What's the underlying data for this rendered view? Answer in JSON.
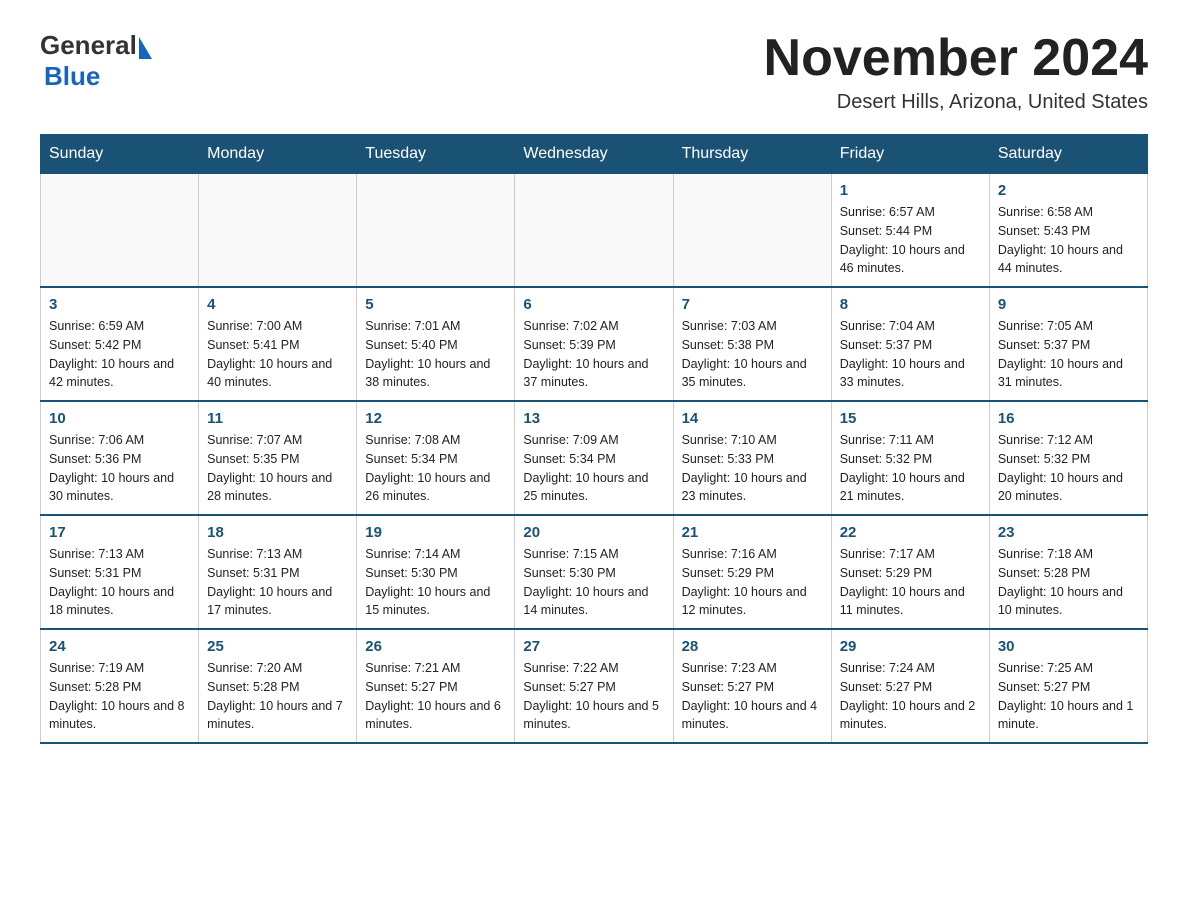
{
  "header": {
    "logo_general": "General",
    "logo_blue": "Blue",
    "month_title": "November 2024",
    "location": "Desert Hills, Arizona, United States"
  },
  "weekdays": [
    "Sunday",
    "Monday",
    "Tuesday",
    "Wednesday",
    "Thursday",
    "Friday",
    "Saturday"
  ],
  "weeks": [
    [
      {
        "day": "",
        "info": ""
      },
      {
        "day": "",
        "info": ""
      },
      {
        "day": "",
        "info": ""
      },
      {
        "day": "",
        "info": ""
      },
      {
        "day": "",
        "info": ""
      },
      {
        "day": "1",
        "info": "Sunrise: 6:57 AM\nSunset: 5:44 PM\nDaylight: 10 hours and 46 minutes."
      },
      {
        "day": "2",
        "info": "Sunrise: 6:58 AM\nSunset: 5:43 PM\nDaylight: 10 hours and 44 minutes."
      }
    ],
    [
      {
        "day": "3",
        "info": "Sunrise: 6:59 AM\nSunset: 5:42 PM\nDaylight: 10 hours and 42 minutes."
      },
      {
        "day": "4",
        "info": "Sunrise: 7:00 AM\nSunset: 5:41 PM\nDaylight: 10 hours and 40 minutes."
      },
      {
        "day": "5",
        "info": "Sunrise: 7:01 AM\nSunset: 5:40 PM\nDaylight: 10 hours and 38 minutes."
      },
      {
        "day": "6",
        "info": "Sunrise: 7:02 AM\nSunset: 5:39 PM\nDaylight: 10 hours and 37 minutes."
      },
      {
        "day": "7",
        "info": "Sunrise: 7:03 AM\nSunset: 5:38 PM\nDaylight: 10 hours and 35 minutes."
      },
      {
        "day": "8",
        "info": "Sunrise: 7:04 AM\nSunset: 5:37 PM\nDaylight: 10 hours and 33 minutes."
      },
      {
        "day": "9",
        "info": "Sunrise: 7:05 AM\nSunset: 5:37 PM\nDaylight: 10 hours and 31 minutes."
      }
    ],
    [
      {
        "day": "10",
        "info": "Sunrise: 7:06 AM\nSunset: 5:36 PM\nDaylight: 10 hours and 30 minutes."
      },
      {
        "day": "11",
        "info": "Sunrise: 7:07 AM\nSunset: 5:35 PM\nDaylight: 10 hours and 28 minutes."
      },
      {
        "day": "12",
        "info": "Sunrise: 7:08 AM\nSunset: 5:34 PM\nDaylight: 10 hours and 26 minutes."
      },
      {
        "day": "13",
        "info": "Sunrise: 7:09 AM\nSunset: 5:34 PM\nDaylight: 10 hours and 25 minutes."
      },
      {
        "day": "14",
        "info": "Sunrise: 7:10 AM\nSunset: 5:33 PM\nDaylight: 10 hours and 23 minutes."
      },
      {
        "day": "15",
        "info": "Sunrise: 7:11 AM\nSunset: 5:32 PM\nDaylight: 10 hours and 21 minutes."
      },
      {
        "day": "16",
        "info": "Sunrise: 7:12 AM\nSunset: 5:32 PM\nDaylight: 10 hours and 20 minutes."
      }
    ],
    [
      {
        "day": "17",
        "info": "Sunrise: 7:13 AM\nSunset: 5:31 PM\nDaylight: 10 hours and 18 minutes."
      },
      {
        "day": "18",
        "info": "Sunrise: 7:13 AM\nSunset: 5:31 PM\nDaylight: 10 hours and 17 minutes."
      },
      {
        "day": "19",
        "info": "Sunrise: 7:14 AM\nSunset: 5:30 PM\nDaylight: 10 hours and 15 minutes."
      },
      {
        "day": "20",
        "info": "Sunrise: 7:15 AM\nSunset: 5:30 PM\nDaylight: 10 hours and 14 minutes."
      },
      {
        "day": "21",
        "info": "Sunrise: 7:16 AM\nSunset: 5:29 PM\nDaylight: 10 hours and 12 minutes."
      },
      {
        "day": "22",
        "info": "Sunrise: 7:17 AM\nSunset: 5:29 PM\nDaylight: 10 hours and 11 minutes."
      },
      {
        "day": "23",
        "info": "Sunrise: 7:18 AM\nSunset: 5:28 PM\nDaylight: 10 hours and 10 minutes."
      }
    ],
    [
      {
        "day": "24",
        "info": "Sunrise: 7:19 AM\nSunset: 5:28 PM\nDaylight: 10 hours and 8 minutes."
      },
      {
        "day": "25",
        "info": "Sunrise: 7:20 AM\nSunset: 5:28 PM\nDaylight: 10 hours and 7 minutes."
      },
      {
        "day": "26",
        "info": "Sunrise: 7:21 AM\nSunset: 5:27 PM\nDaylight: 10 hours and 6 minutes."
      },
      {
        "day": "27",
        "info": "Sunrise: 7:22 AM\nSunset: 5:27 PM\nDaylight: 10 hours and 5 minutes."
      },
      {
        "day": "28",
        "info": "Sunrise: 7:23 AM\nSunset: 5:27 PM\nDaylight: 10 hours and 4 minutes."
      },
      {
        "day": "29",
        "info": "Sunrise: 7:24 AM\nSunset: 5:27 PM\nDaylight: 10 hours and 2 minutes."
      },
      {
        "day": "30",
        "info": "Sunrise: 7:25 AM\nSunset: 5:27 PM\nDaylight: 10 hours and 1 minute."
      }
    ]
  ]
}
